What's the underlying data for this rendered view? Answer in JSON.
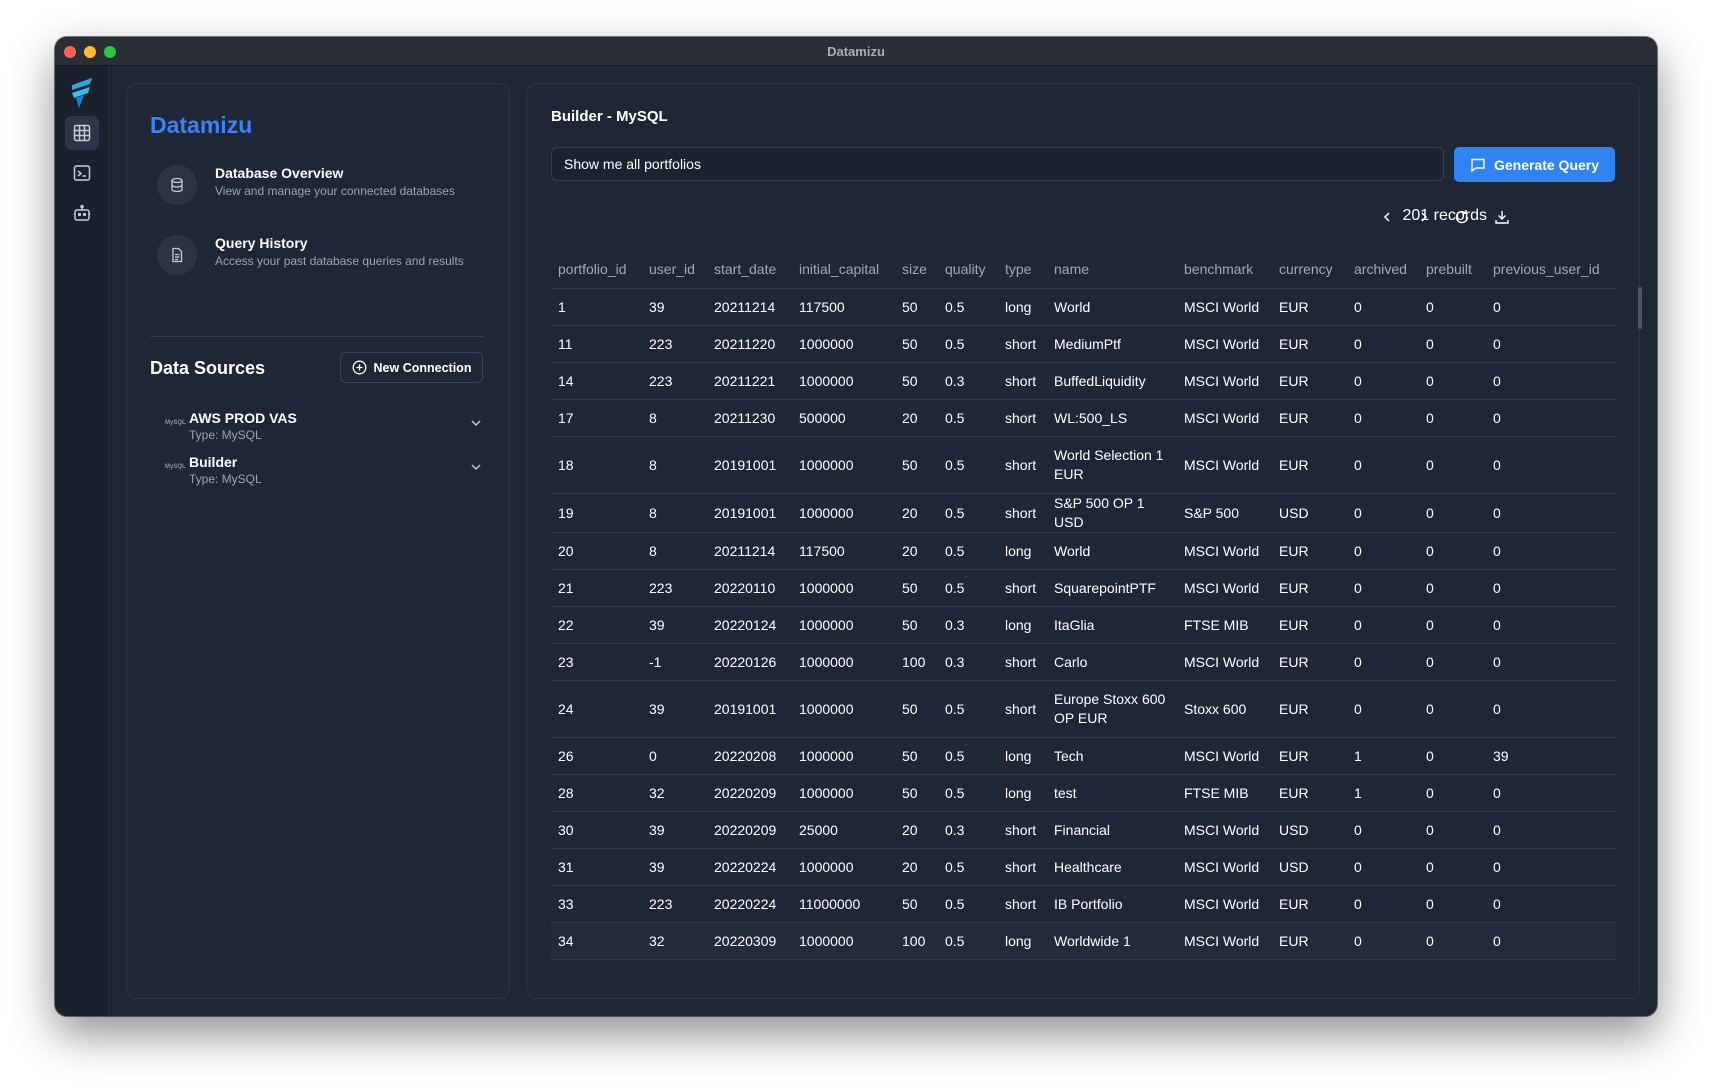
{
  "window": {
    "title": "Datamizu"
  },
  "sidebar": {
    "brand": "Datamizu",
    "nav": [
      {
        "title": "Database Overview",
        "desc": "View and manage your connected databases",
        "icon": "database-icon"
      },
      {
        "title": "Query History",
        "desc": "Access your past database queries and results",
        "icon": "document-icon"
      }
    ],
    "data_sources_title": "Data Sources",
    "new_connection_label": "New Connection",
    "sources": [
      {
        "name": "AWS PROD VAS",
        "type": "Type: MySQL",
        "logo": "MySQL"
      },
      {
        "name": "Builder",
        "type": "Type: MySQL",
        "logo": "MySQL"
      }
    ]
  },
  "main": {
    "title": "Builder - MySQL",
    "query_value": "Show me all portfolios",
    "generate_label": "Generate Query",
    "records_label": "201 records"
  },
  "table": {
    "columns": [
      "portfolio_id",
      "user_id",
      "start_date",
      "initial_capital",
      "size",
      "quality",
      "type",
      "name",
      "benchmark",
      "currency",
      "archived",
      "prebuilt",
      "previous_user_id"
    ],
    "rows": [
      [
        "1",
        "39",
        "20211214",
        "117500",
        "50",
        "0.5",
        "long",
        "World",
        "MSCI World",
        "EUR",
        "0",
        "0",
        "0"
      ],
      [
        "11",
        "223",
        "20211220",
        "1000000",
        "50",
        "0.5",
        "short",
        "MediumPtf",
        "MSCI World",
        "EUR",
        "0",
        "0",
        "0"
      ],
      [
        "14",
        "223",
        "20211221",
        "1000000",
        "50",
        "0.3",
        "short",
        "BuffedLiquidity",
        "MSCI World",
        "EUR",
        "0",
        "0",
        "0"
      ],
      [
        "17",
        "8",
        "20211230",
        "500000",
        "20",
        "0.5",
        "short",
        "WL:500_LS",
        "MSCI World",
        "EUR",
        "0",
        "0",
        "0"
      ],
      [
        "18",
        "8",
        "20191001",
        "1000000",
        "50",
        "0.5",
        "short",
        "World Selection 1 EUR",
        "MSCI World",
        "EUR",
        "0",
        "0",
        "0"
      ],
      [
        "19",
        "8",
        "20191001",
        "1000000",
        "20",
        "0.5",
        "short",
        "S&P 500 OP 1 USD",
        "S&P 500",
        "USD",
        "0",
        "0",
        "0"
      ],
      [
        "20",
        "8",
        "20211214",
        "117500",
        "20",
        "0.5",
        "long",
        "World",
        "MSCI World",
        "EUR",
        "0",
        "0",
        "0"
      ],
      [
        "21",
        "223",
        "20220110",
        "1000000",
        "50",
        "0.5",
        "short",
        "SquarepointPTF",
        "MSCI World",
        "EUR",
        "0",
        "0",
        "0"
      ],
      [
        "22",
        "39",
        "20220124",
        "1000000",
        "50",
        "0.3",
        "long",
        "ItaGlia",
        "FTSE MIB",
        "EUR",
        "0",
        "0",
        "0"
      ],
      [
        "23",
        "-1",
        "20220126",
        "1000000",
        "100",
        "0.3",
        "short",
        "Carlo",
        "MSCI World",
        "EUR",
        "0",
        "0",
        "0"
      ],
      [
        "24",
        "39",
        "20191001",
        "1000000",
        "50",
        "0.5",
        "short",
        "Europe Stoxx 600 OP EUR",
        "Stoxx 600",
        "EUR",
        "0",
        "0",
        "0"
      ],
      [
        "26",
        "0",
        "20220208",
        "1000000",
        "50",
        "0.5",
        "long",
        "Tech",
        "MSCI World",
        "EUR",
        "1",
        "0",
        "39"
      ],
      [
        "28",
        "32",
        "20220209",
        "1000000",
        "50",
        "0.5",
        "long",
        "test",
        "FTSE MIB",
        "EUR",
        "1",
        "0",
        "0"
      ],
      [
        "30",
        "39",
        "20220209",
        "25000",
        "20",
        "0.3",
        "short",
        "Financial",
        "MSCI World",
        "USD",
        "0",
        "0",
        "0"
      ],
      [
        "31",
        "39",
        "20220224",
        "1000000",
        "20",
        "0.5",
        "short",
        "Healthcare",
        "MSCI World",
        "USD",
        "0",
        "0",
        "0"
      ],
      [
        "33",
        "223",
        "20220224",
        "11000000",
        "50",
        "0.5",
        "short",
        "IB Portfolio",
        "MSCI World",
        "EUR",
        "0",
        "0",
        "0"
      ],
      [
        "34",
        "32",
        "20220309",
        "1000000",
        "100",
        "0.5",
        "long",
        "Worldwide 1",
        "MSCI World",
        "EUR",
        "0",
        "0",
        "0"
      ]
    ]
  },
  "colors": {
    "accent": "#3b82f6",
    "button": "#2f84f2",
    "background": "#1e2533",
    "panel": "#1f2736"
  }
}
